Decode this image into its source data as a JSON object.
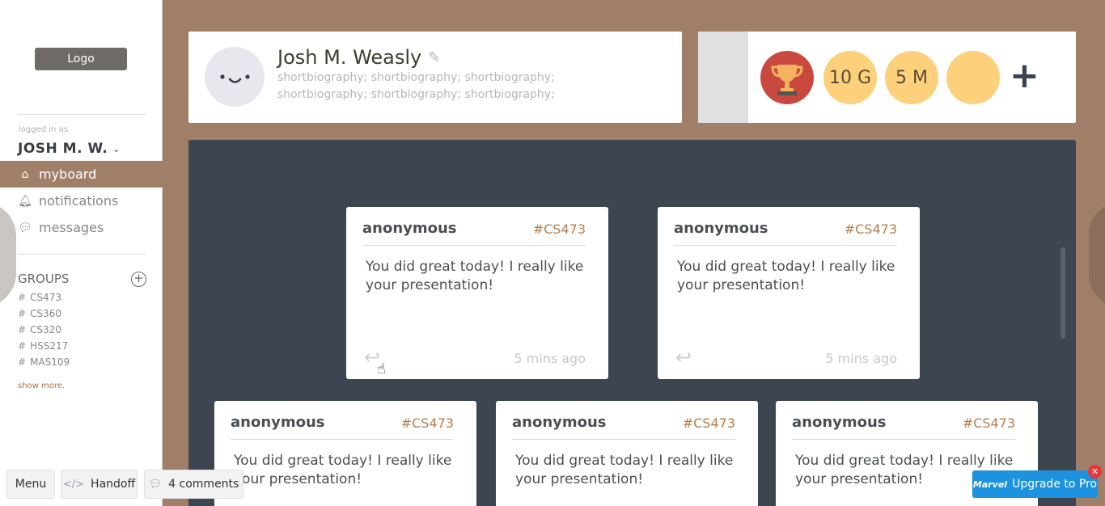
{
  "sidebar": {
    "logo": "Logo",
    "logged_in_label": "logged in as",
    "user": "JOSH M. W.",
    "nav": [
      {
        "label": "myboard",
        "icon": "home-icon",
        "active": true
      },
      {
        "label": "notifications",
        "icon": "bell-icon",
        "active": false
      },
      {
        "label": "messages",
        "icon": "chat-icon",
        "active": false
      }
    ],
    "groups_title": "GROUPS",
    "groups": [
      "CS473",
      "CS360",
      "CS320",
      "HSS217",
      "MAS109"
    ],
    "show_more": "show more."
  },
  "profile": {
    "name": "Josh M. Weasly",
    "bio": "shortbiography; shortbiography; shortbiography; shortbiography; shortbiography; shortbiography;"
  },
  "badges": [
    {
      "label": "",
      "icon": "trophy-icon"
    },
    {
      "label": "10 G"
    },
    {
      "label": "5 M"
    },
    {
      "label": ""
    }
  ],
  "notes": [
    {
      "author": "anonymous",
      "tag": "#CS473",
      "text": "You did great today! I really like your presentation!",
      "time": "5 mins ago"
    },
    {
      "author": "anonymous",
      "tag": "#CS473",
      "text": "You did great today! I really like your presentation!",
      "time": "5 mins ago"
    },
    {
      "author": "anonymous",
      "tag": "#CS473",
      "text": "You did great today! I really like your presentation!",
      "time": ""
    },
    {
      "author": "anonymous",
      "tag": "#CS473",
      "text": "You did great today! I really like your presentation!",
      "time": ""
    },
    {
      "author": "anonymous",
      "tag": "#CS473",
      "text": "You did great today! I really like your presentation!",
      "time": ""
    }
  ],
  "toolbar": {
    "menu": "Menu",
    "handoff": "Handoff",
    "comments": "4 comments",
    "upgrade": "Upgrade to Pro",
    "marvel": "Marvel"
  }
}
